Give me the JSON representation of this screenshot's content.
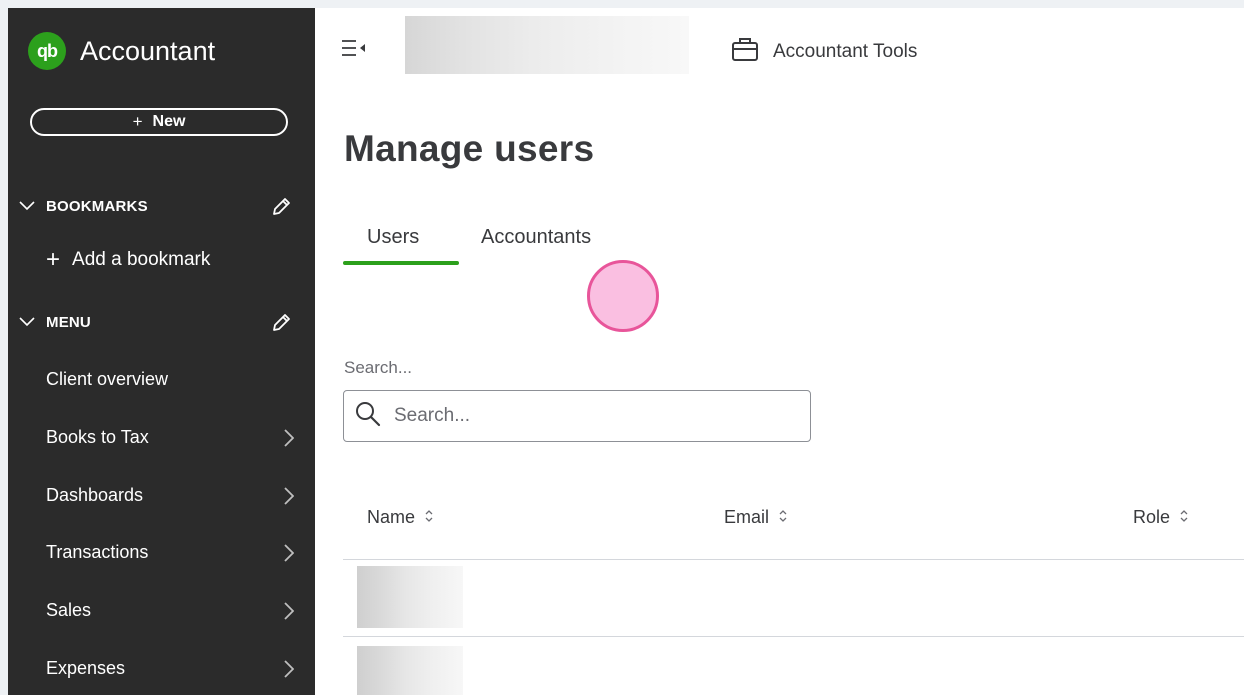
{
  "sidebar": {
    "brand": "Accountant",
    "logo_text": "qb",
    "new_button": "New",
    "bookmarks_heading": "BOOKMARKS",
    "add_bookmark": "Add a bookmark",
    "menu_heading": "MENU",
    "menu_items": [
      {
        "label": "Client overview",
        "has_arrow": false
      },
      {
        "label": "Books to Tax",
        "has_arrow": true
      },
      {
        "label": "Dashboards",
        "has_arrow": true
      },
      {
        "label": "Transactions",
        "has_arrow": true
      },
      {
        "label": "Sales",
        "has_arrow": true
      },
      {
        "label": "Expenses",
        "has_arrow": true
      }
    ]
  },
  "topbar": {
    "accountant_tools": "Accountant Tools"
  },
  "page": {
    "title": "Manage users",
    "tabs": [
      {
        "label": "Users",
        "active": true
      },
      {
        "label": "Accountants",
        "active": false
      }
    ],
    "search": {
      "label": "Search...",
      "placeholder": "Search..."
    },
    "table": {
      "columns": [
        "Name",
        "Email",
        "Role"
      ]
    }
  },
  "colors": {
    "sidebar_bg": "#2b2b2b",
    "brand_green": "#2ca01c",
    "text_dark": "#393a3d",
    "cursor_highlight": "#e8559a"
  },
  "icons": [
    "qb-logo-icon",
    "chevron-down-icon",
    "pencil-icon",
    "plus-icon",
    "chevron-right-icon",
    "hamburger-collapse-icon",
    "briefcase-icon",
    "search-icon",
    "sort-icon"
  ]
}
